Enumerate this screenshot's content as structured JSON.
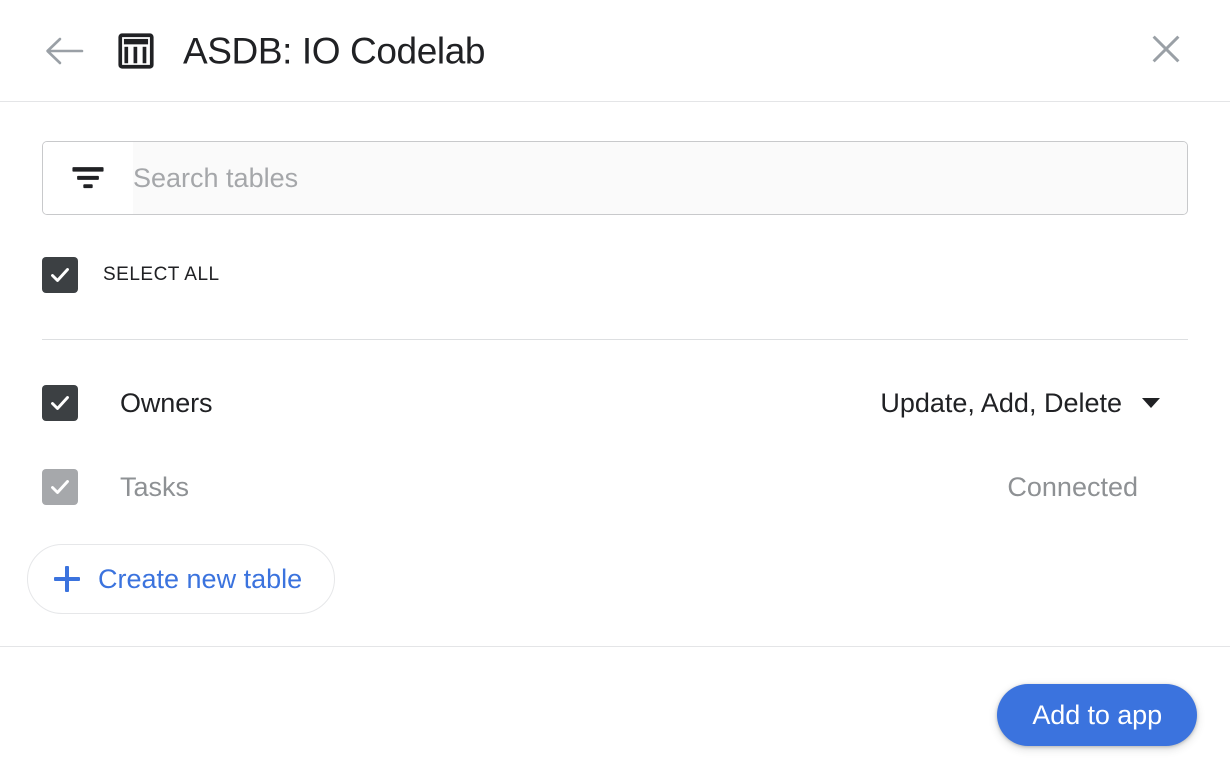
{
  "header": {
    "title": "ASDB: IO Codelab",
    "back_icon": "arrow-left-icon",
    "app_icon": "table-icon",
    "close_icon": "close-icon"
  },
  "search": {
    "placeholder": "Search tables",
    "value": "",
    "icon": "filter-icon"
  },
  "select_all": {
    "label": "SELECT ALL",
    "checked": true
  },
  "tables": [
    {
      "name": "Owners",
      "checked": true,
      "enabled": true,
      "status": "Update, Add, Delete",
      "has_dropdown": true
    },
    {
      "name": "Tasks",
      "checked": true,
      "enabled": false,
      "status": "Connected",
      "has_dropdown": false
    }
  ],
  "create_table": {
    "label": "Create new table",
    "icon": "plus-icon"
  },
  "footer": {
    "primary_button": "Add to app"
  },
  "colors": {
    "accent": "#3b73de",
    "checkbox": "#3c4043",
    "checkbox_disabled": "#a6a8ab",
    "muted_text": "#8e9194",
    "divider": "#e4e5e7"
  }
}
